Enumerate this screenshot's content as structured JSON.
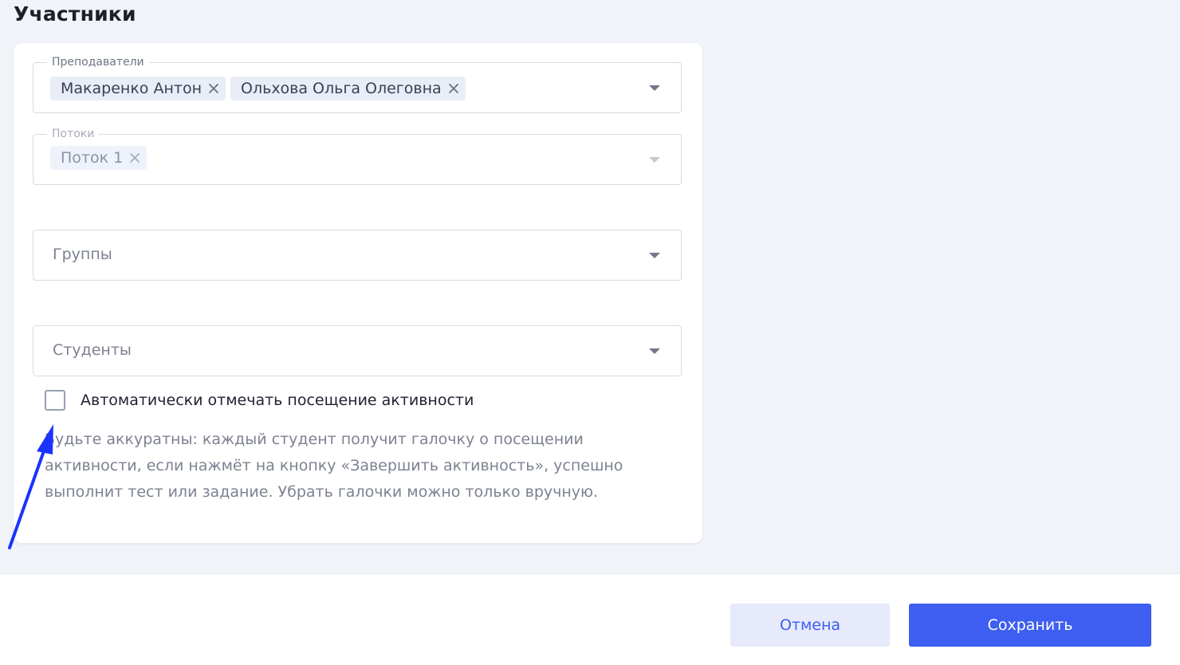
{
  "section": {
    "title": "Участники"
  },
  "fields": {
    "teachers": {
      "label": "Преподаватели",
      "chips": [
        "Макаренко Антон",
        "Ольхова Ольга Олеговна"
      ]
    },
    "streams": {
      "label": "Потоки",
      "chips": [
        "Поток 1"
      ],
      "disabled": true
    },
    "groups": {
      "placeholder": "Группы"
    },
    "students": {
      "placeholder": "Студенты"
    }
  },
  "auto_attendance": {
    "label": "Автоматически отмечать посещение активности",
    "checked": false,
    "hint": "Будьте аккуратны: каждый студент получит галочку о посещении активности, если нажмёт на кнопку «Завершить активность», успешно выполнит тест или задание. Убрать галочки можно только вручную."
  },
  "footer": {
    "cancel_label": "Отмена",
    "save_label": "Сохранить"
  },
  "colors": {
    "primary": "#3d5ef0",
    "secondary_button_bg": "#e7eafb",
    "chip_bg": "#e8edf8",
    "page_bg": "#f0f3f8",
    "annotation_arrow": "#1a33ff"
  },
  "icons": {
    "chip_remove": "close-icon",
    "dropdown": "chevron-down-icon"
  }
}
